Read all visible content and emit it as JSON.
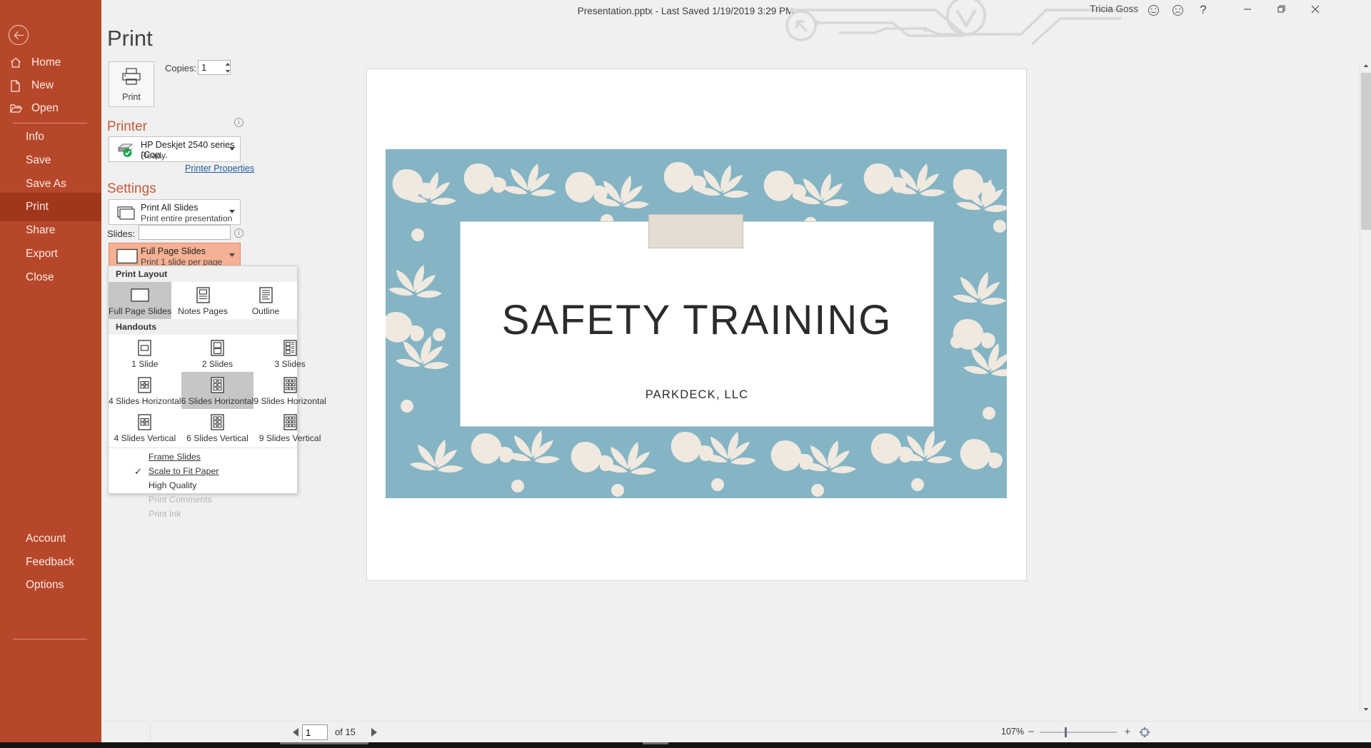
{
  "window": {
    "title": "Presentation.pptx  -  Last Saved 1/19/2019 3:29 PM",
    "user": "Tricia Goss",
    "help_glyph": "?",
    "icons": {
      "smile": "smile-icon",
      "frown": "frown-icon",
      "minimize": "minimize-icon",
      "restore": "restore-icon",
      "close": "close-icon"
    }
  },
  "sidebar": {
    "back_label": "Back",
    "items": [
      {
        "label": "Home",
        "icon": "home-icon",
        "active": false
      },
      {
        "label": "New",
        "icon": "file-icon",
        "active": false
      },
      {
        "label": "Open",
        "icon": "folder-icon",
        "active": false
      },
      {
        "label": "Info",
        "icon": "",
        "active": false
      },
      {
        "label": "Save",
        "icon": "",
        "active": false
      },
      {
        "label": "Save As",
        "icon": "",
        "active": false
      },
      {
        "label": "Print",
        "icon": "",
        "active": true
      },
      {
        "label": "Share",
        "icon": "",
        "active": false
      },
      {
        "label": "Export",
        "icon": "",
        "active": false
      },
      {
        "label": "Close",
        "icon": "",
        "active": false
      }
    ],
    "bottom_items": [
      {
        "label": "Account"
      },
      {
        "label": "Feedback"
      },
      {
        "label": "Options"
      }
    ]
  },
  "print": {
    "heading": "Print",
    "print_button_label": "Print",
    "print_button_icon": "printer-icon",
    "copies_label": "Copies:",
    "copies_value": "1",
    "printer_heading": "Printer",
    "printer_name": "HP Deskjet 2540 series (Cop...",
    "printer_status": "Ready",
    "printer_icon": "printer-ready-icon",
    "printer_properties_link": "Printer Properties",
    "settings_heading": "Settings",
    "print_range_main": "Print All Slides",
    "print_range_sub": "Print entire presentation",
    "slides_label": "Slides:",
    "slides_value": "",
    "layout_main": "Full Page Slides",
    "layout_sub": "Print 1 slide per page"
  },
  "layout_menu": {
    "group_print_layout": "Print Layout",
    "print_layout_items": [
      {
        "label": "Full Page Slides",
        "icon": "full-page-icon",
        "selected": true
      },
      {
        "label": "Notes Pages",
        "icon": "notes-pages-icon",
        "selected": false
      },
      {
        "label": "Outline",
        "icon": "outline-icon",
        "selected": false
      }
    ],
    "group_handouts": "Handouts",
    "handout_items": [
      {
        "label": "1 Slide",
        "icon": "handout-1-icon",
        "selected": false
      },
      {
        "label": "2 Slides",
        "icon": "handout-2-icon",
        "selected": false
      },
      {
        "label": "3 Slides",
        "icon": "handout-3-icon",
        "selected": false
      },
      {
        "label": "4 Slides Horizontal",
        "icon": "handout-4h-icon",
        "selected": false
      },
      {
        "label": "6 Slides Horizontal",
        "icon": "handout-6h-icon",
        "selected": true
      },
      {
        "label": "9 Slides Horizontal",
        "icon": "handout-9h-icon",
        "selected": false
      },
      {
        "label": "4 Slides Vertical",
        "icon": "handout-4v-icon",
        "selected": false
      },
      {
        "label": "6 Slides Vertical",
        "icon": "handout-6v-icon",
        "selected": false
      },
      {
        "label": "9 Slides Vertical",
        "icon": "handout-9v-icon",
        "selected": false
      }
    ],
    "toggle_items": [
      {
        "label": "Frame Slides",
        "checked": false,
        "disabled": false,
        "accel": "F"
      },
      {
        "label": "Scale to Fit Paper",
        "checked": true,
        "disabled": false,
        "accel": "S"
      },
      {
        "label": "High Quality",
        "checked": false,
        "disabled": false,
        "accel": ""
      },
      {
        "label": "Print Comments",
        "checked": false,
        "disabled": true,
        "accel": ""
      },
      {
        "label": "Print Ink",
        "checked": false,
        "disabled": true,
        "accel": ""
      }
    ]
  },
  "preview": {
    "slide_title": "SAFETY TRAINING",
    "slide_subtitle": "PARKDECK, LLC"
  },
  "statusbar": {
    "page_value": "1",
    "page_of": "of 15",
    "prev_label": "Previous Page",
    "next_label": "Next Page",
    "zoom_percent": "107%",
    "zoom_out_glyph": "−",
    "zoom_in_glyph": "+",
    "fit_slide_label": "Zoom to Page"
  },
  "colors": {
    "accent": "#b7472a",
    "accent_active": "#a0371d",
    "section_heading": "#c55a3c",
    "highlight": "#f5b193",
    "link": "#1f5a99",
    "slide_bg": "#85b4c4"
  }
}
